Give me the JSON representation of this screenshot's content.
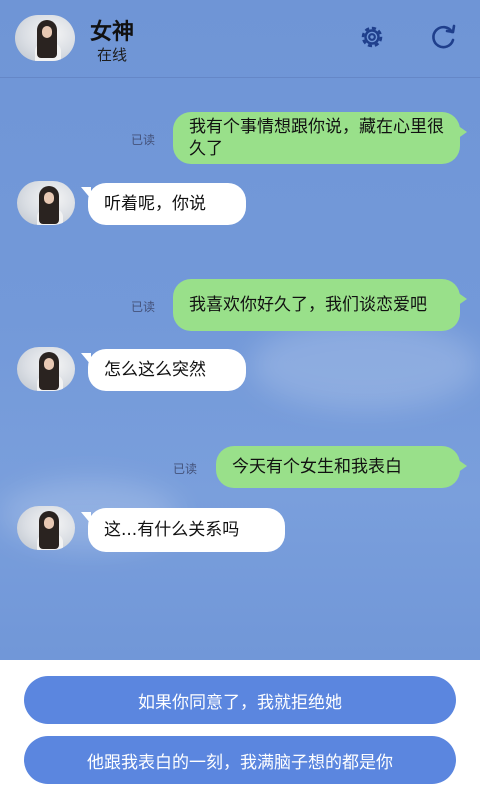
{
  "header": {
    "title": "女神",
    "status": "在线",
    "settings_icon": "gear-icon",
    "refresh_icon": "refresh-icon"
  },
  "messages": [
    {
      "side": "out",
      "read": "已读",
      "text": "我有个事情想跟你说，藏在心里很久了"
    },
    {
      "side": "in",
      "text": "听着呢，你说"
    },
    {
      "side": "out",
      "read": "已读",
      "text": "我喜欢你好久了，我们谈恋爱吧"
    },
    {
      "side": "in",
      "text": "怎么这么突然"
    },
    {
      "side": "out",
      "read": "已读",
      "text": "今天有个女生和我表白"
    },
    {
      "side": "in",
      "text": "这...有什么关系吗"
    }
  ],
  "choices": [
    {
      "label": "如果你同意了，我就拒绝她"
    },
    {
      "label": "他跟我表白的一刻，我满脑子想的都是你"
    }
  ],
  "colors": {
    "background": "#7399d9",
    "outgoing_bubble": "#99e08a",
    "incoming_bubble": "#ffffff",
    "choice_button": "#5b86df"
  }
}
